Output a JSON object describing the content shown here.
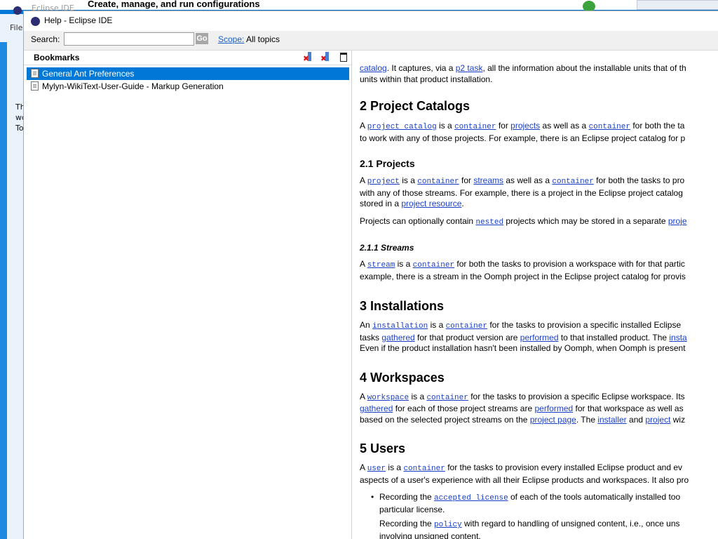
{
  "background": {
    "window_title": "Eclipse IDE",
    "menu": "File",
    "dialog_title": "Create, manage, and run configurations",
    "side_text": [
      "Th",
      "wo",
      "To"
    ]
  },
  "help_window": {
    "title": "Help - Eclipse IDE",
    "search_label": "Search:",
    "search_value": "",
    "go_label": "Go",
    "scope_label": "Scope:",
    "scope_value": "All topics"
  },
  "bookmarks": {
    "title": "Bookmarks",
    "items": [
      {
        "label": "General Ant Preferences",
        "selected": true
      },
      {
        "label": "Mylyn-WikiText-User-Guide - Markup Generation",
        "selected": false
      }
    ]
  },
  "content": {
    "top_line1_link": "catalog",
    "top_line1_text": ". It captures, via a ",
    "top_line1_link2": "p2 task",
    "top_line1_text2": ", all the information about the installable units that of th",
    "top_line2": "units within that product installation.",
    "h2_project_catalogs": "2  Project Catalogs",
    "p_pc": [
      "A ",
      "project catalog",
      " is a ",
      "container",
      " for ",
      "projects",
      " as well as a ",
      "container",
      " for both the ta"
    ],
    "p_pc2": "to work with any of those projects. For example, there is an Eclipse project catalog for p",
    "h3_projects": "2.1  Projects",
    "p_pr": [
      "A ",
      "project",
      " is a ",
      "container",
      " for ",
      "streams",
      " as well as a ",
      "container",
      " for both the tasks to pro"
    ],
    "p_pr2": "with any of those streams. For example, there is a project in the Eclipse project catalog",
    "p_pr3": [
      "stored in a ",
      "project resource",
      "."
    ],
    "p_nested": [
      "Projects can optionally contain ",
      "nested",
      " projects which may be stored in a separate ",
      "proje"
    ],
    "h4_streams": "2.1.1  Streams",
    "p_st": [
      "A ",
      "stream",
      " is a ",
      "container",
      " for both the tasks to provision a workspace with for that partic"
    ],
    "p_st2": "example, there is a stream in the Oomph project in the Eclipse project catalog for provis",
    "h2_installations": "3  Installations",
    "p_in": [
      "An ",
      "installation",
      " is a ",
      "container",
      " for the tasks to provision a specific installed Eclipse"
    ],
    "p_in2": [
      "tasks ",
      "gathered",
      " for that product version are ",
      "performed",
      " to that installed product. The ",
      "insta"
    ],
    "p_in3": "Even if the product installation hasn't been installed by Oomph, when Oomph is present",
    "h2_workspaces": "4  Workspaces",
    "p_ws": [
      "A ",
      "workspace",
      " is a ",
      "container",
      " for the tasks to provision a specific Eclipse workspace. Its"
    ],
    "p_ws2": [
      "gathered",
      " for each of those project streams are ",
      "performed",
      " for that workspace as well as"
    ],
    "p_ws3": [
      "based on the selected project streams on the ",
      "project page",
      ". The ",
      "installer",
      " and ",
      "project",
      " wiz"
    ],
    "h2_users": "5  Users",
    "p_us": [
      "A ",
      "user",
      " is a ",
      "container",
      " for the tasks to provision every installed Eclipse product and ev"
    ],
    "p_us2": "aspects of a user's experience with all their Eclipse products and workspaces. It also pro",
    "li1": [
      "Recording the ",
      "accepted license",
      " of each of the tools automatically installed too"
    ],
    "li1b": "particular license.",
    "li2": [
      "Recording the ",
      "policy",
      " with regard to handling of unsigned content, i.e., once uns"
    ],
    "li2b": "involving unsigned content."
  }
}
